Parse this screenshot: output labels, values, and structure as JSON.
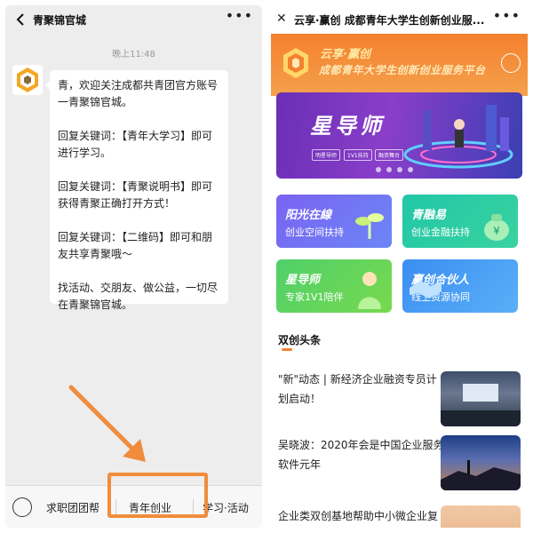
{
  "chat": {
    "title": "青聚锦官城",
    "time": "晚上11:48",
    "message_lines": [
      [
        "青，欢迎关注成都共青团官方账号",
        "一青聚锦官城。"
      ],
      [
        "回复关键词：【青年大学习】即可",
        "进行学习。"
      ],
      [
        "回复关键词：【青聚说明书】即可",
        "获得青聚正确打开方式！"
      ],
      [
        "回复关键词：【二维码】即可和朋",
        "友共享青聚哦～"
      ],
      [
        "找活动、交朋友、做公益，一切尽",
        "在青聚锦官城。"
      ]
    ],
    "menu": {
      "item1": "求职团团帮",
      "item2": "青年创业",
      "item3": "学习·活动"
    }
  },
  "mini": {
    "title": "云享·赢创 成都青年大学生创新创业服...",
    "brand_name": "云享·赢创",
    "brand_sub": "成都青年大学生创新创业服务平台",
    "banner": {
      "title": "星导师",
      "tags": [
        "明星导师",
        "1V1扶持",
        "融资舞台"
      ]
    },
    "cards": [
      {
        "title": "阳光在線",
        "sub": "创业空间扶持"
      },
      {
        "title": "青融易",
        "sub": "创业金融扶持"
      },
      {
        "title": "星导师",
        "sub": "专家1V1陪伴"
      },
      {
        "title": "赢创合伙人",
        "sub": "线上资源协同"
      }
    ],
    "section_title": "双创头条",
    "news": [
      [
        "\"新\"动态 | 新经济企业融资专员计",
        "划启动！"
      ],
      [
        "吴晓波：2020年会是中国企业服务",
        "软件元年"
      ],
      [
        "企业类双创基地帮助中小微企业复",
        ""
      ]
    ]
  },
  "colors": {
    "accent_orange": "#f5802e",
    "chat_bg": "#ededed",
    "banner_purple": "#6a2fb6"
  },
  "icons": [
    "back-arrow-icon",
    "more-dots-icon",
    "close-icon",
    "user-icon",
    "keyboard-icon",
    "logo-icon",
    "pointer-arrow-icon"
  ]
}
